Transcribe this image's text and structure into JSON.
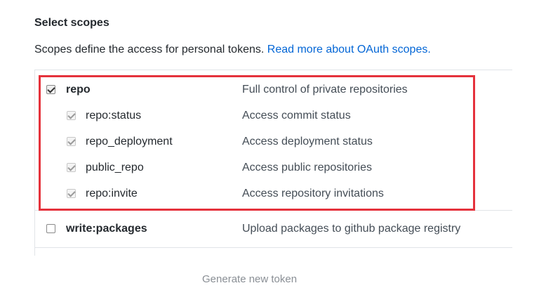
{
  "section": {
    "title": "Select scopes",
    "description": "Scopes define the access for personal tokens.",
    "link_label": "Read more about OAuth scopes."
  },
  "scopes": [
    {
      "name": "repo",
      "description": "Full control of private repositories",
      "checked": true,
      "child": false
    },
    {
      "name": "repo:status",
      "description": "Access commit status",
      "checked": true,
      "child": true
    },
    {
      "name": "repo_deployment",
      "description": "Access deployment status",
      "checked": true,
      "child": true
    },
    {
      "name": "public_repo",
      "description": "Access public repositories",
      "checked": true,
      "child": true
    },
    {
      "name": "repo:invite",
      "description": "Access repository invitations",
      "checked": true,
      "child": true
    },
    {
      "name": "write:packages",
      "description": "Upload packages to github package registry",
      "checked": false,
      "child": false
    }
  ],
  "colors": {
    "highlight": "#e5323c",
    "link": "#0366d6"
  },
  "generate_button_label": "Generate new token"
}
